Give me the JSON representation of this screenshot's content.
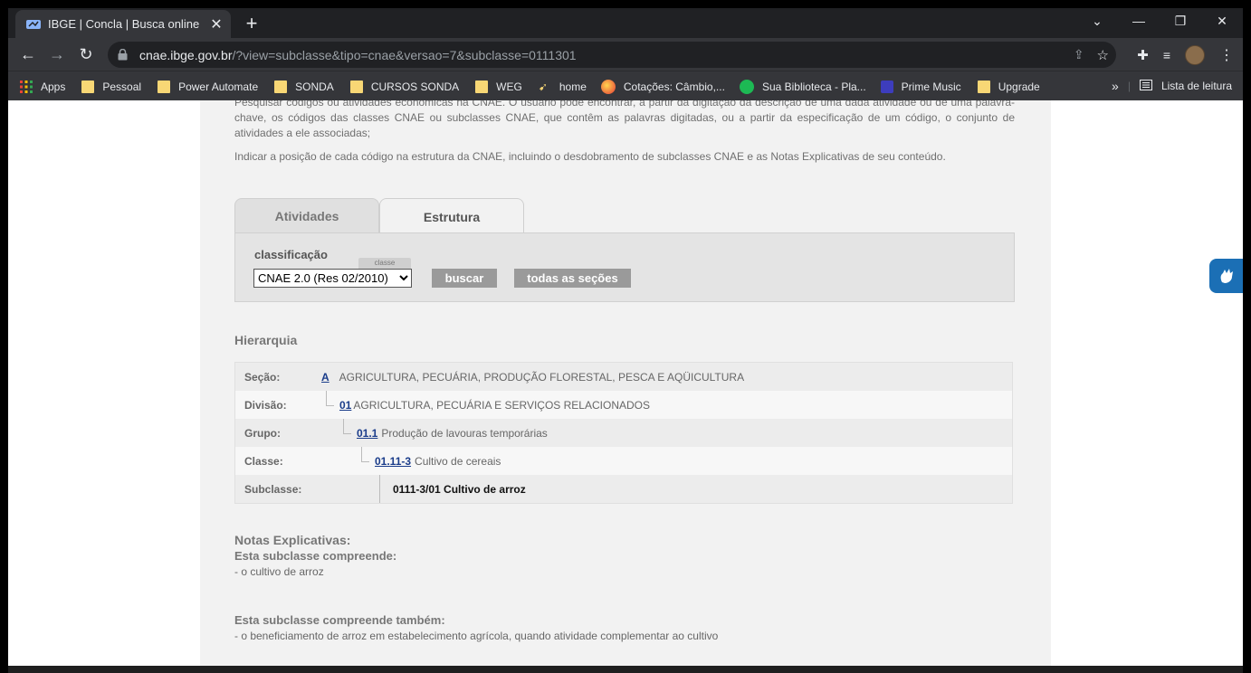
{
  "browser": {
    "tab_title": "IBGE | Concla | Busca online",
    "new_tab_label": "+",
    "url_host": "cnae.ibge.gov.br",
    "url_path": "/?view=subclasse&tipo=cnae&versao=7&subclasse=0111301",
    "bookmarks": [
      {
        "label": "Apps",
        "icon": "apps-grid-icon"
      },
      {
        "label": "Pessoal",
        "icon": "folder-icon"
      },
      {
        "label": "Power Automate",
        "icon": "folder-icon"
      },
      {
        "label": "SONDA",
        "icon": "folder-icon"
      },
      {
        "label": "CURSOS SONDA",
        "icon": "folder-icon"
      },
      {
        "label": "WEG",
        "icon": "folder-icon"
      },
      {
        "label": "home",
        "icon": "home-site-icon"
      },
      {
        "label": "Cotações: Câmbio,...",
        "icon": "globe-icon"
      },
      {
        "label": "Sua Biblioteca - Pla...",
        "icon": "spotify-icon"
      },
      {
        "label": "Prime Music",
        "icon": "prime-music-icon"
      },
      {
        "label": "Upgrade",
        "icon": "folder-icon"
      }
    ],
    "reading_list": "Lista de leitura",
    "more_bookmarks": "»",
    "colors": {
      "frame": "#202124",
      "toolbar": "#35363a",
      "folder": "#f8d775"
    }
  },
  "page": {
    "intro_partial": "Pesquisar códigos ou atividades econômicas na CNAE. O usuário pode encontrar, a partir da digitação da descrição de uma dada atividade ou de uma palavra-chave, os códigos das classes CNAE ou subclasses CNAE, que contêm as palavras digitadas, ou a partir da especificação de um código, o conjunto de atividades a ele associadas;",
    "intro_2": "Indicar a posição de cada código na estrutura da CNAE, incluindo o desdobramento de subclasses CNAE e as Notas Explicativas de seu conteúdo.",
    "tabs": [
      {
        "label": "Atividades",
        "active": false
      },
      {
        "label": "Estrutura",
        "active": true
      }
    ],
    "search": {
      "label": "classificação",
      "tag": "classe",
      "selected": "CNAE 2.0 (Res 02/2010)",
      "buscar": "buscar",
      "todas": "todas as seções"
    },
    "hierarchy_title": "Hierarquia",
    "hierarchy": [
      {
        "key": "Seção:",
        "code": "A",
        "desc": "AGRICULTURA, PECUÁRIA, PRODUÇÃO FLORESTAL, PESCA E AQÜICULTURA"
      },
      {
        "key": "Divisão:",
        "code": "01",
        "desc": "AGRICULTURA, PECUÁRIA E SERVIÇOS RELACIONADOS"
      },
      {
        "key": "Grupo:",
        "code": "01.1",
        "desc": "Produção de lavouras temporárias"
      },
      {
        "key": "Classe:",
        "code": "01.11-3",
        "desc": "Cultivo de cereais"
      },
      {
        "key": "Subclasse:",
        "code": "",
        "desc": "0111-3/01 Cultivo de arroz"
      }
    ],
    "notes_title": "Notas Explicativas:",
    "compreende_title": "Esta subclasse compreende:",
    "compreende_items": [
      "- o cultivo de arroz"
    ],
    "tambem_title": "Esta subclasse compreende também:",
    "tambem_items": [
      "- o beneficiamento de arroz em estabelecimento agrícola, quando atividade complementar ao cultivo"
    ],
    "accent_link": "#1a3c8a"
  }
}
